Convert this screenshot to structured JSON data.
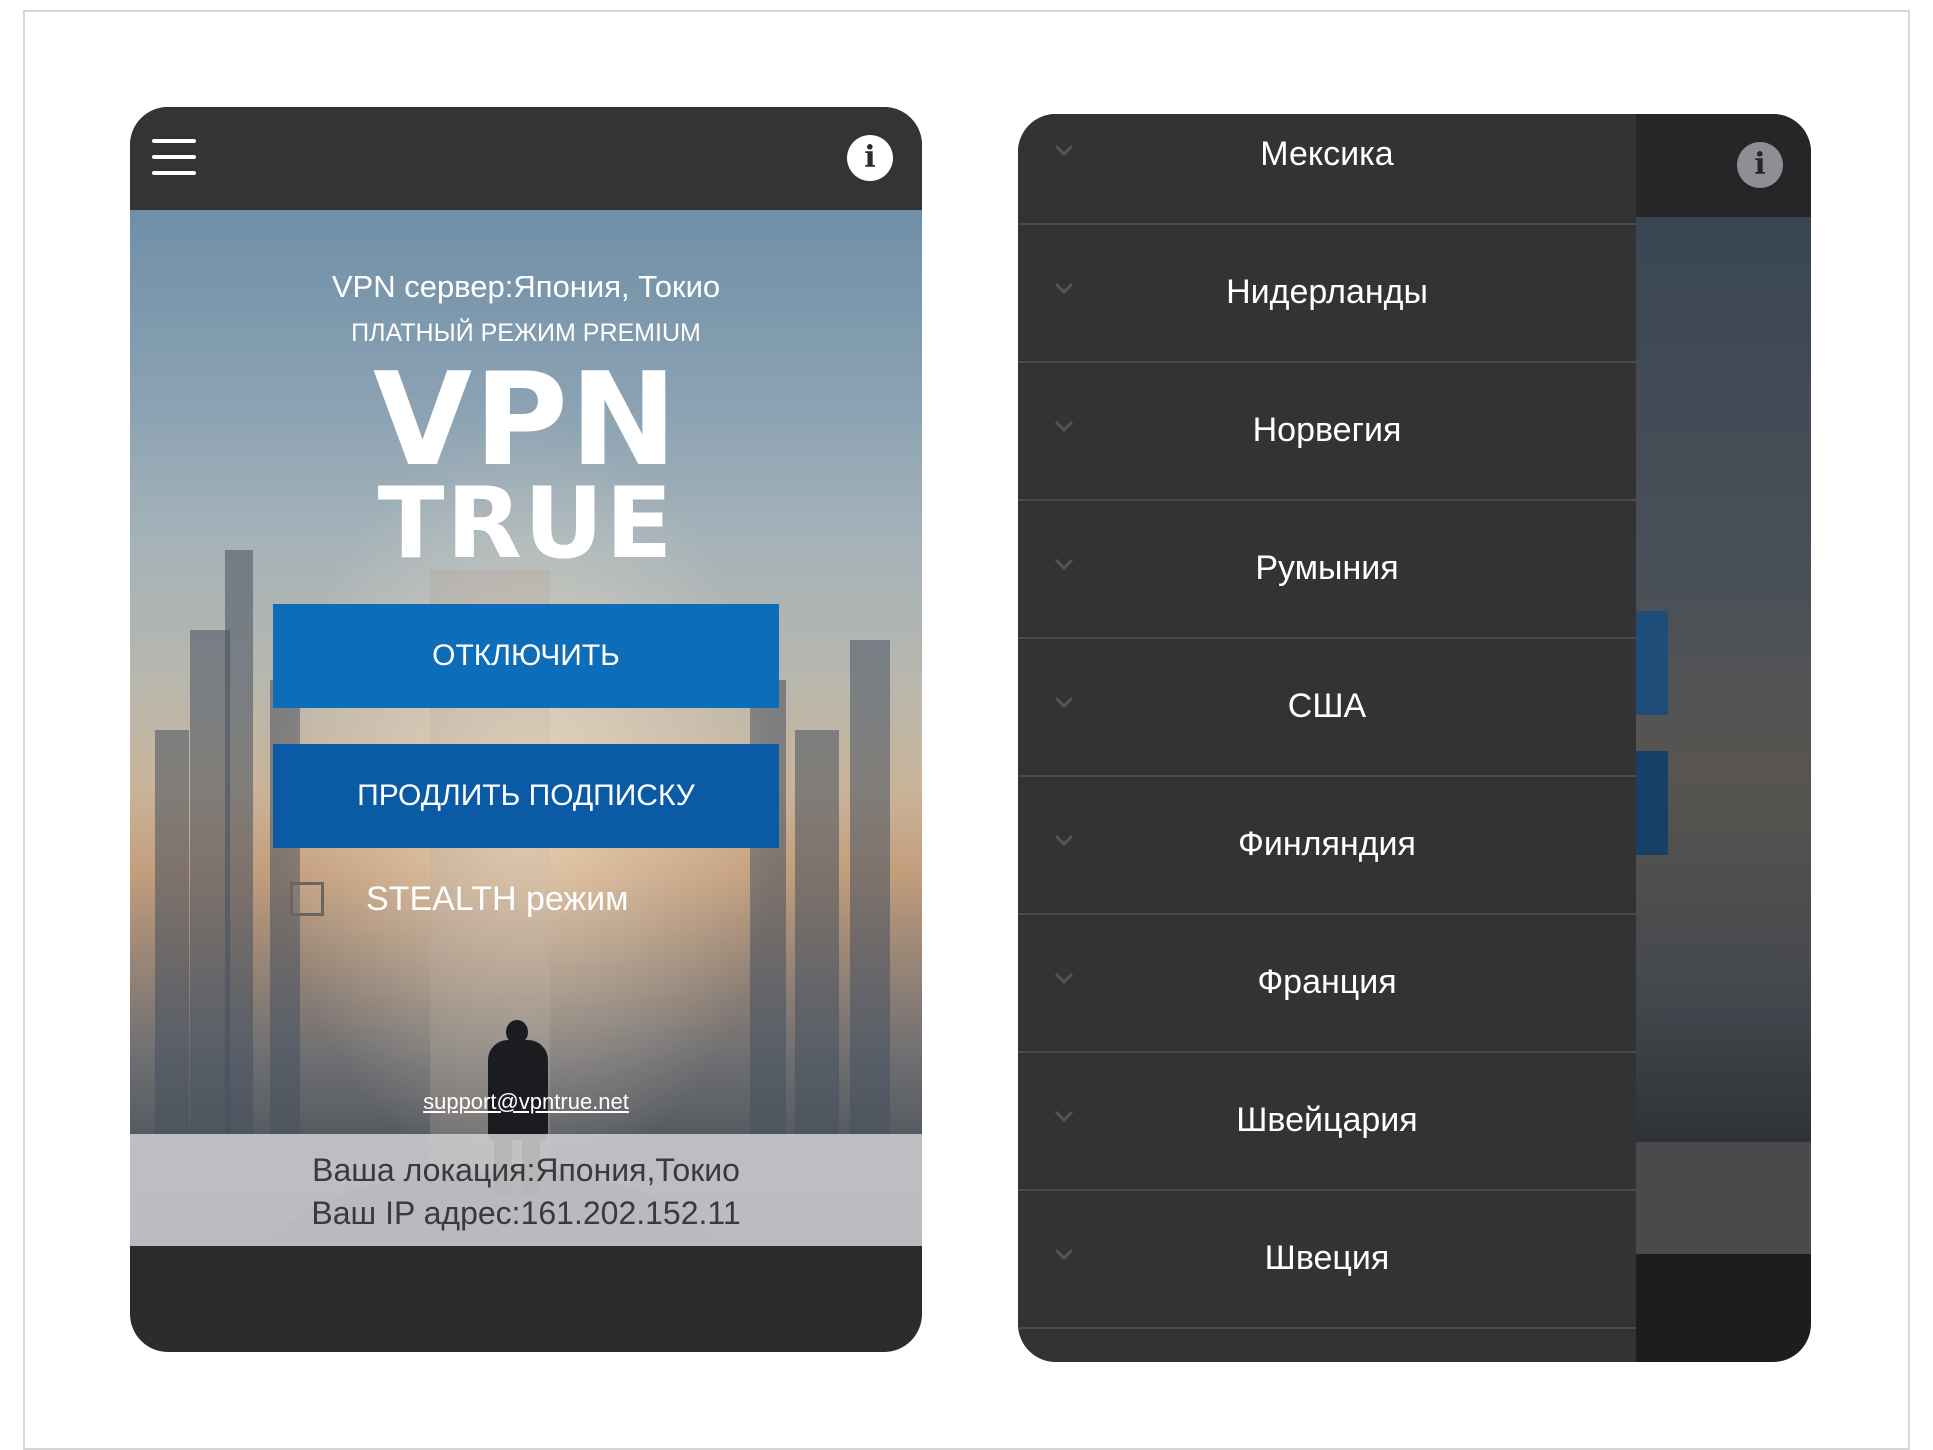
{
  "left_screen": {
    "server_text": "VPN сервер:Япония, Токио",
    "mode_text": "ПЛАТНЫЙ РЕЖИМ PREMIUM",
    "logo_line1": "VPN",
    "logo_line2": "TRUE",
    "disconnect_label": "ОТКЛЮЧИТЬ",
    "renew_label": "ПРОДЛИТЬ ПОДПИСКУ",
    "stealth_label": "STEALTH режим",
    "stealth_checked": false,
    "support_email": "support@vpntrue.net",
    "location_line": "Ваша локация:Япония,Токио",
    "ip_line": "Ваш IP адрес:161.202.152.11",
    "info_glyph": "i"
  },
  "right_screen": {
    "info_glyph": "i",
    "countries": [
      "Мексика",
      "Нидерланды",
      "Норвегия",
      "Румыния",
      "США",
      "Финляндия",
      "Франция",
      "Швейцария",
      "Швеция"
    ]
  },
  "colors": {
    "topbar": "#343436",
    "primary_button": "#0e6db8",
    "secondary_button": "#0b5aa6",
    "drawer_bg": "#333335"
  },
  "icons": [
    "menu-icon",
    "info-icon",
    "chevron-down-icon"
  ]
}
